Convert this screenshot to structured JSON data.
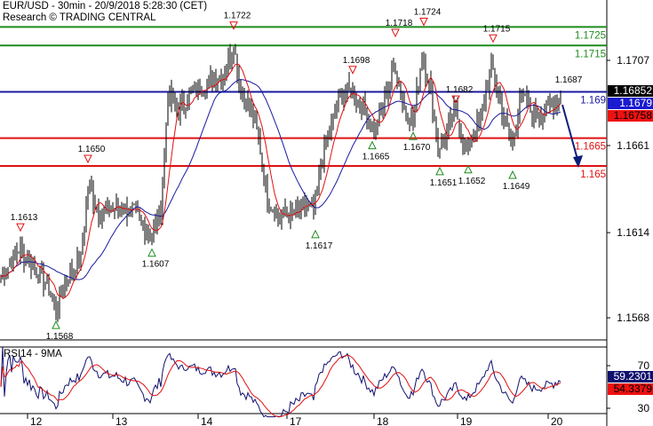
{
  "header": {
    "title": "EUR/USD - 30min - 20/9/2018 5:28:30 (CET)",
    "source": "Research © TRADING CENTRAL"
  },
  "colors": {
    "up_line": "#1e8c1e",
    "blue": "#1a1aa0",
    "red": "#e01010",
    "arrow": "#0a1f7a",
    "rsi": "#10106e",
    "rsi_ma": "#e01010"
  },
  "chart_data": [
    {
      "type": "line",
      "title": "EUR/USD - 30min",
      "x_unit": "bar (30min)",
      "ylim": [
        1.1535,
        1.174
      ],
      "y_ticks": [
        "1.1707",
        "1.1661",
        "1.1614",
        "1.1568"
      ],
      "y_tick_values": [
        1.1707,
        1.1661,
        1.1614,
        1.1568
      ],
      "x_ticks": [
        {
          "label": "12",
          "bar": 15
        },
        {
          "label": "13",
          "bar": 63
        },
        {
          "label": "14",
          "bar": 111
        },
        {
          "label": "17",
          "bar": 161
        },
        {
          "label": "18",
          "bar": 210
        },
        {
          "label": "19",
          "bar": 257
        },
        {
          "label": "20",
          "bar": 308
        }
      ],
      "price_path": [
        [
          0,
          1.159
        ],
        [
          10,
          1.1605
        ],
        [
          17,
          1.1598
        ],
        [
          27,
          1.1585
        ],
        [
          31,
          1.1572
        ],
        [
          37,
          1.159
        ],
        [
          45,
          1.16
        ],
        [
          49,
          1.164
        ],
        [
          55,
          1.1625
        ],
        [
          65,
          1.1628
        ],
        [
          75,
          1.1625
        ],
        [
          84,
          1.1612
        ],
        [
          90,
          1.1625
        ],
        [
          94,
          1.1688
        ],
        [
          100,
          1.168
        ],
        [
          108,
          1.169
        ],
        [
          125,
          1.17
        ],
        [
          131,
          1.1715
        ],
        [
          135,
          1.169
        ],
        [
          140,
          1.1682
        ],
        [
          145,
          1.1665
        ],
        [
          150,
          1.1632
        ],
        [
          157,
          1.1622
        ],
        [
          167,
          1.1625
        ],
        [
          172,
          1.163
        ],
        [
          176,
          1.1624
        ],
        [
          180,
          1.165
        ],
        [
          187,
          1.1675
        ],
        [
          192,
          1.169
        ],
        [
          197,
          1.169
        ],
        [
          205,
          1.168
        ],
        [
          210,
          1.1668
        ],
        [
          217,
          1.169
        ],
        [
          222,
          1.1705
        ],
        [
          227,
          1.168
        ],
        [
          232,
          1.1675
        ],
        [
          237,
          1.171
        ],
        [
          242,
          1.169
        ],
        [
          246,
          1.166
        ],
        [
          252,
          1.167
        ],
        [
          256,
          1.168
        ],
        [
          262,
          1.1658
        ],
        [
          270,
          1.1675
        ],
        [
          276,
          1.1705
        ],
        [
          282,
          1.168
        ],
        [
          288,
          1.166
        ],
        [
          292,
          1.1688
        ],
        [
          300,
          1.1678
        ],
        [
          307,
          1.168
        ],
        [
          315,
          1.1687
        ]
      ],
      "levels": [
        {
          "label": "1.1725",
          "value": 1.1725,
          "color": "#1e8c1e"
        },
        {
          "label": "1.1715",
          "value": 1.1715,
          "color": "#1e8c1e"
        },
        {
          "label": "1.169",
          "value": 1.169,
          "color": "#1a1aa0"
        },
        {
          "label": "1.1665",
          "value": 1.1665,
          "color": "#e01010"
        },
        {
          "label": "1.165",
          "value": 1.165,
          "color": "#e01010"
        }
      ],
      "highs": [
        {
          "label": "1.1613",
          "bar": 11,
          "value": 1.1613
        },
        {
          "label": "1.1650",
          "bar": 49,
          "value": 1.165
        },
        {
          "label": "1.1722",
          "bar": 131,
          "value": 1.1722
        },
        {
          "label": "1.1698",
          "bar": 198,
          "value": 1.1698
        },
        {
          "label": "1.1718",
          "bar": 222,
          "value": 1.1718
        },
        {
          "label": "1.1724",
          "bar": 238,
          "value": 1.1724
        },
        {
          "label": "1.1682",
          "bar": 256,
          "value": 1.1682
        },
        {
          "label": "1.1715",
          "bar": 277,
          "value": 1.1715
        }
      ],
      "lows": [
        {
          "label": "1.1568",
          "bar": 31,
          "value": 1.1568
        },
        {
          "label": "1.1607",
          "bar": 85,
          "value": 1.1607
        },
        {
          "label": "1.1617",
          "bar": 177,
          "value": 1.1617
        },
        {
          "label": "1.1665",
          "bar": 209,
          "value": 1.1665
        },
        {
          "label": "1.1670",
          "bar": 232,
          "value": 1.167
        },
        {
          "label": "1.1651",
          "bar": 247,
          "value": 1.1651
        },
        {
          "label": "1.1652",
          "bar": 263,
          "value": 1.1652
        },
        {
          "label": "1.1649",
          "bar": 288,
          "value": 1.1649
        }
      ],
      "note_label": "1.1687",
      "forecast_arrow": {
        "from_bar": 316,
        "from": 1.1683,
        "to_bar": 325,
        "to": 1.165
      },
      "price_tags": [
        {
          "label": "1.16852",
          "bg": "#000000",
          "fg": "#ffffff"
        },
        {
          "label": "1.1679",
          "bg": "#1a1ad0",
          "fg": "#ffffff"
        },
        {
          "label": "1.16758",
          "bg": "#ee1111",
          "fg": "#000000"
        }
      ]
    },
    {
      "type": "line",
      "title": "RSI14 - 9MA",
      "ylim": [
        20,
        90
      ],
      "y_ticks": [
        "70",
        "30"
      ],
      "y_tick_values": [
        70,
        30
      ],
      "series": [
        {
          "name": "RSI14",
          "color": "#10106e",
          "last": "59.2301"
        },
        {
          "name": "9MA",
          "color": "#e01010",
          "last": "54.3379"
        }
      ]
    }
  ]
}
